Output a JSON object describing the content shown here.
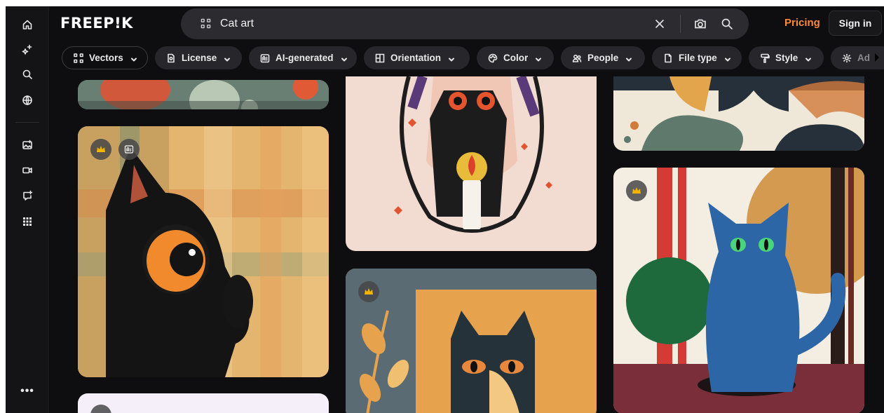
{
  "brand": {
    "logo_text": "FREEP!K",
    "accent": "#ff8a3d"
  },
  "rail": {
    "items": [
      {
        "icon": "home-icon"
      },
      {
        "icon": "sparkle-tools-icon"
      },
      {
        "icon": "search-icon"
      },
      {
        "icon": "globe-icon"
      },
      {
        "icon": "image-generator-icon"
      },
      {
        "icon": "video-icon"
      },
      {
        "icon": "chat-assistant-icon"
      },
      {
        "icon": "apps-grid-icon"
      }
    ],
    "more_label": "•••"
  },
  "search": {
    "value": "Cat art",
    "scope_icon": "vectors-icon",
    "actions": [
      "clear-icon",
      "camera-search-icon",
      "search-icon"
    ]
  },
  "header": {
    "pricing_label": "Pricing",
    "signin_label": "Sign in"
  },
  "filters": [
    {
      "label": "Vectors",
      "icon": "vectors-icon"
    },
    {
      "label": "License",
      "icon": "license-icon"
    },
    {
      "label": "AI-generated",
      "icon": "ai-icon"
    },
    {
      "label": "Orientation",
      "icon": "orientation-icon"
    },
    {
      "label": "Color",
      "icon": "palette-icon"
    },
    {
      "label": "People",
      "icon": "people-icon"
    },
    {
      "label": "File type",
      "icon": "file-icon"
    },
    {
      "label": "Style",
      "icon": "brush-icon"
    },
    {
      "label": "Ad",
      "icon": "settings-icon"
    }
  ],
  "results": [
    {
      "subject": "abstract shapes banner",
      "premium": false
    },
    {
      "subject": "black cat peeking behind curtain",
      "premium": true,
      "ai_generated": true
    },
    {
      "subject": "black cat with candle in branch wreath",
      "premium": false
    },
    {
      "subject": "abstract cat shapes",
      "premium": false
    },
    {
      "subject": "blue cat sitting",
      "premium": true
    },
    {
      "subject": "cat face with leaves",
      "premium": true
    },
    {
      "subject": "partial light card",
      "premium": false
    }
  ]
}
